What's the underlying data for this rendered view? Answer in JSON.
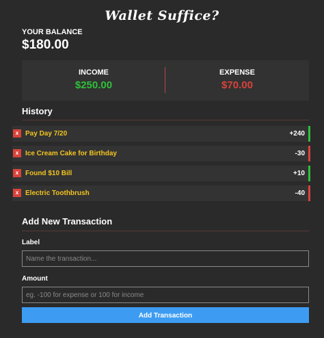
{
  "app": {
    "title": "Wallet Suffice?"
  },
  "balance": {
    "label": "YOUR BALANCE",
    "value": "$180.00"
  },
  "summary": {
    "income_label": "INCOME",
    "income_value": "$250.00",
    "expense_label": "EXPENSE",
    "expense_value": "$70.00"
  },
  "colors": {
    "income": "#2ec13a",
    "expense": "#d9433a",
    "label_text": "#f2c421",
    "button": "#3d9cf2",
    "background": "#2a2a2a"
  },
  "history": {
    "title": "History",
    "delete_glyph": "x",
    "items": [
      {
        "label": "Pay Day 7/20",
        "amount": "+240",
        "type": "income"
      },
      {
        "label": "Ice Cream Cake for Birthday",
        "amount": "-30",
        "type": "expense"
      },
      {
        "label": "Found $10 Bill",
        "amount": "+10",
        "type": "income"
      },
      {
        "label": "Electric Toothbrush",
        "amount": "-40",
        "type": "expense"
      }
    ]
  },
  "form": {
    "title": "Add New Transaction",
    "label_field": {
      "label": "Label",
      "placeholder": "Name the transaction...",
      "value": ""
    },
    "amount_field": {
      "label": "Amount",
      "placeholder": "eg. -100 for expense or 100 for income",
      "value": ""
    },
    "submit_label": "Add Transaction"
  }
}
